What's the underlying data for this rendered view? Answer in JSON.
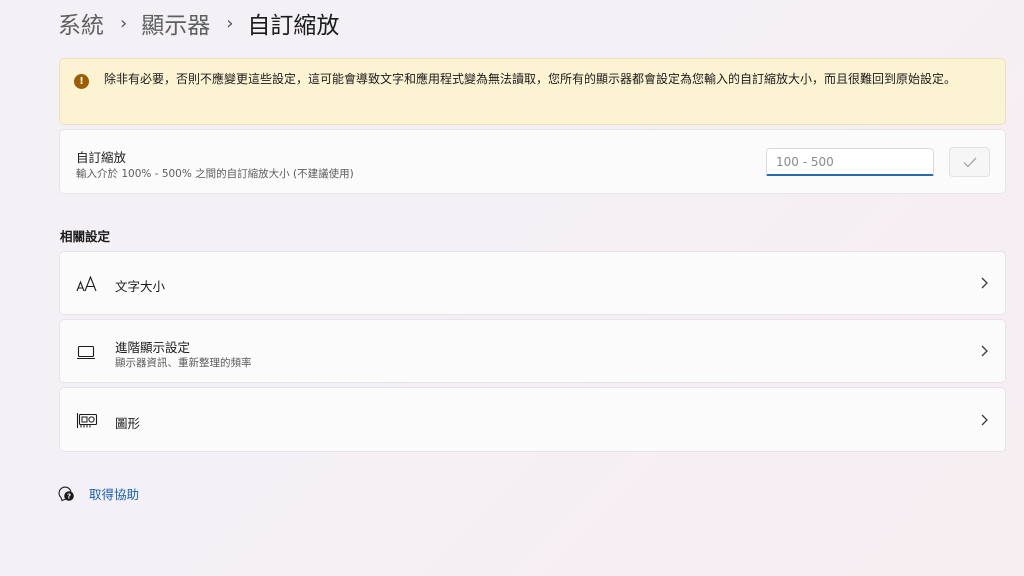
{
  "breadcrumb": {
    "items": [
      "系統",
      "顯示器"
    ],
    "current": "自訂縮放",
    "separator": "›"
  },
  "warning": {
    "text": "除非有必要，否則不應變更這些設定，這可能會導致文字和應用程式變為無法讀取，您所有的顯示器都會設定為您輸入的自訂縮放大小，而且很難回到原始設定。",
    "icon": "warning-icon"
  },
  "custom_scaling": {
    "title": "自訂縮放",
    "description": "輸入介於 100% - 500% 之間的自訂縮放大小 (不建議使用)",
    "input_value": "",
    "input_placeholder": "100 - 500",
    "confirm_icon": "checkmark-icon"
  },
  "related": {
    "heading": "相關設定",
    "items": [
      {
        "title": "文字大小",
        "subtitle": "",
        "icon": "text-size-icon"
      },
      {
        "title": "進階顯示設定",
        "subtitle": "顯示器資訊、重新整理的頻率",
        "icon": "monitor-icon"
      },
      {
        "title": "圖形",
        "subtitle": "",
        "icon": "graphics-card-icon"
      }
    ]
  },
  "help": {
    "label": "取得協助",
    "icon": "help-icon"
  },
  "colors": {
    "accent": "#2a6ab3",
    "link": "#1a5fb4",
    "warning_bg": "#fcf3d3",
    "warning_icon": "#9d5d00"
  }
}
